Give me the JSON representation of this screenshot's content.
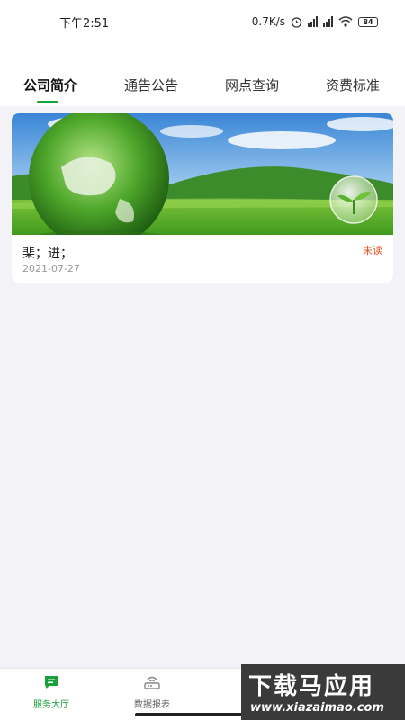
{
  "status": {
    "time": "下午2:51",
    "speed": "0.7K/s",
    "battery": "84"
  },
  "tabs": [
    "公司简介",
    "通告公告",
    "网点查询",
    "资费标准"
  ],
  "card": {
    "title": "棐；进；",
    "date": "2021-07-27",
    "badge": "未读"
  },
  "nav": {
    "service": "服务大厅",
    "report": "数据报表"
  },
  "watermark": {
    "main": "下载马应用",
    "sub": "www.xiazaimao.com"
  },
  "colors": {
    "accent": "#1aa03b",
    "badge": "#e8501c"
  }
}
